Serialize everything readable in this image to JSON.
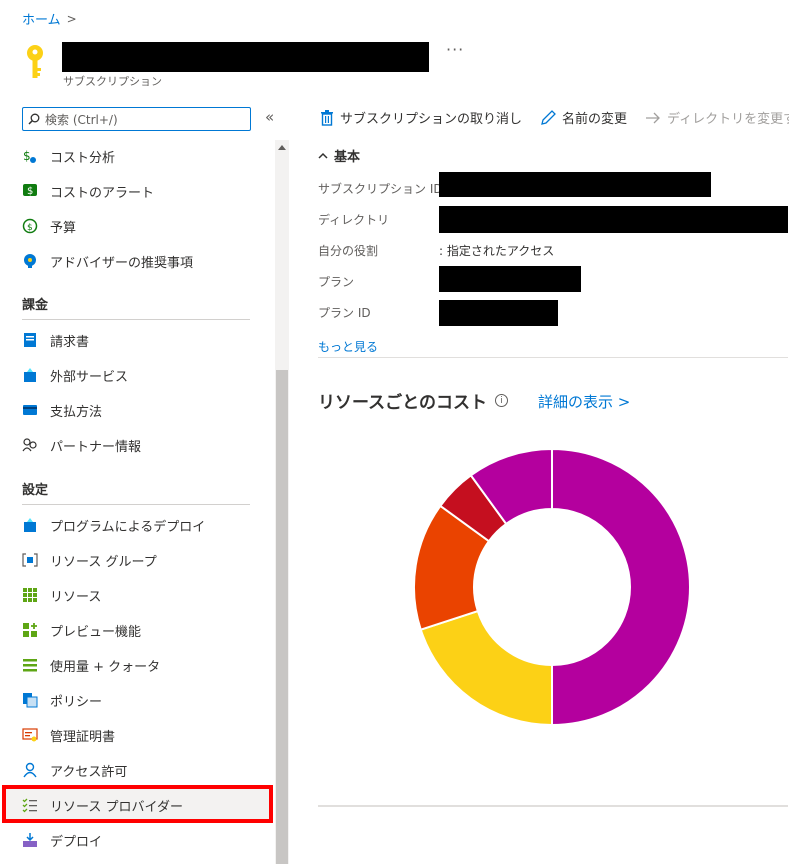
{
  "breadcrumb": {
    "home": "ホーム",
    "separator": ">"
  },
  "header": {
    "subtitle": "サブスクリプション",
    "more": "···"
  },
  "search": {
    "placeholder": "検索 (Ctrl+/)",
    "collapse": "«"
  },
  "sidebar": {
    "top_items": [
      {
        "label": "コスト分析",
        "icon": "cost-analysis-icon"
      },
      {
        "label": "コストのアラート",
        "icon": "cost-alert-icon"
      },
      {
        "label": "予算",
        "icon": "budget-icon"
      },
      {
        "label": "アドバイザーの推奨事項",
        "icon": "advisor-icon"
      }
    ],
    "billing_title": "課金",
    "billing_items": [
      {
        "label": "請求書",
        "icon": "invoice-icon"
      },
      {
        "label": "外部サービス",
        "icon": "external-services-icon"
      },
      {
        "label": "支払方法",
        "icon": "payment-method-icon"
      },
      {
        "label": "パートナー情報",
        "icon": "partner-info-icon"
      }
    ],
    "settings_title": "設定",
    "settings_items": [
      {
        "label": "プログラムによるデプロイ",
        "icon": "programmatic-deploy-icon"
      },
      {
        "label": "リソース グループ",
        "icon": "resource-group-icon"
      },
      {
        "label": "リソース",
        "icon": "resources-icon"
      },
      {
        "label": "プレビュー機能",
        "icon": "preview-features-icon"
      },
      {
        "label": "使用量 + クォータ",
        "icon": "usage-quota-icon"
      },
      {
        "label": "ポリシー",
        "icon": "policy-icon"
      },
      {
        "label": "管理証明書",
        "icon": "management-cert-icon"
      },
      {
        "label": "アクセス許可",
        "icon": "permissions-icon"
      },
      {
        "label": "リソース プロバイダー",
        "icon": "resource-providers-icon"
      },
      {
        "label": "デプロイ",
        "icon": "deployments-icon"
      }
    ]
  },
  "toolbar": {
    "cancel_subscription": "サブスクリプションの取り消し",
    "rename": "名前の変更",
    "change_directory": "ディレクトリを変更する"
  },
  "essentials": {
    "toggle_label": "基本",
    "subscription_id_label": "サブスクリプション ID",
    "directory_label": "ディレクトリ",
    "my_role_label": "自分の役割",
    "my_role_value": ": 指定されたアクセス",
    "plan_label": "プラン",
    "plan_id_label": "プラン ID",
    "more_link": "もっと見る"
  },
  "cost": {
    "title": "リソースごとのコスト",
    "details_link": "詳細の表示 >"
  },
  "chart_data": {
    "type": "pie",
    "style": "donut",
    "slices": [
      {
        "value": 50,
        "color": "#b4009e"
      },
      {
        "value": 20,
        "color": "#fcd116"
      },
      {
        "value": 15,
        "color": "#ea4300"
      },
      {
        "value": 5,
        "color": "#c50f1f"
      },
      {
        "value": 10,
        "color": "#b4009e"
      }
    ]
  },
  "colors": {
    "accent": "#0078d4",
    "highlight": "#ff0000"
  }
}
